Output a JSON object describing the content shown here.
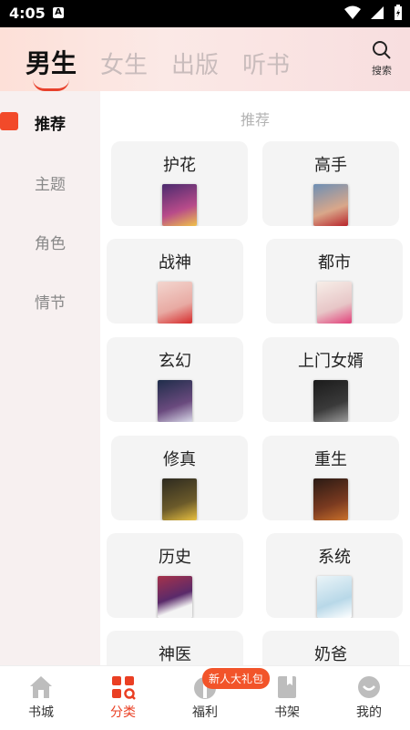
{
  "status_bar": {
    "time": "4:05",
    "app_icon_letter": "A"
  },
  "top_tabs": [
    {
      "label": "男生",
      "active": true
    },
    {
      "label": "女生",
      "active": false
    },
    {
      "label": "出版",
      "active": false
    },
    {
      "label": "听书",
      "active": false
    }
  ],
  "search": {
    "label": "搜索"
  },
  "sidebar": {
    "items": [
      {
        "label": "推荐",
        "active": true
      },
      {
        "label": "主题",
        "active": false
      },
      {
        "label": "角色",
        "active": false
      },
      {
        "label": "情节",
        "active": false
      }
    ]
  },
  "content": {
    "section_title": "推荐",
    "cards": [
      {
        "label": "护花"
      },
      {
        "label": "高手"
      },
      {
        "label": "战神"
      },
      {
        "label": "都市"
      },
      {
        "label": "玄幻"
      },
      {
        "label": "上门女婿"
      },
      {
        "label": "修真"
      },
      {
        "label": "重生"
      },
      {
        "label": "历史"
      },
      {
        "label": "系统"
      },
      {
        "label": "神医"
      },
      {
        "label": "奶爸"
      }
    ]
  },
  "bottom_nav": [
    {
      "label": "书城",
      "active": false
    },
    {
      "label": "分类",
      "active": true
    },
    {
      "label": "福利",
      "active": false
    },
    {
      "label": "书架",
      "active": false
    },
    {
      "label": "我的",
      "active": false
    }
  ],
  "gift_badge": "新人大礼包",
  "colors": {
    "accent": "#ea3f23",
    "marker": "#f24a2a"
  }
}
